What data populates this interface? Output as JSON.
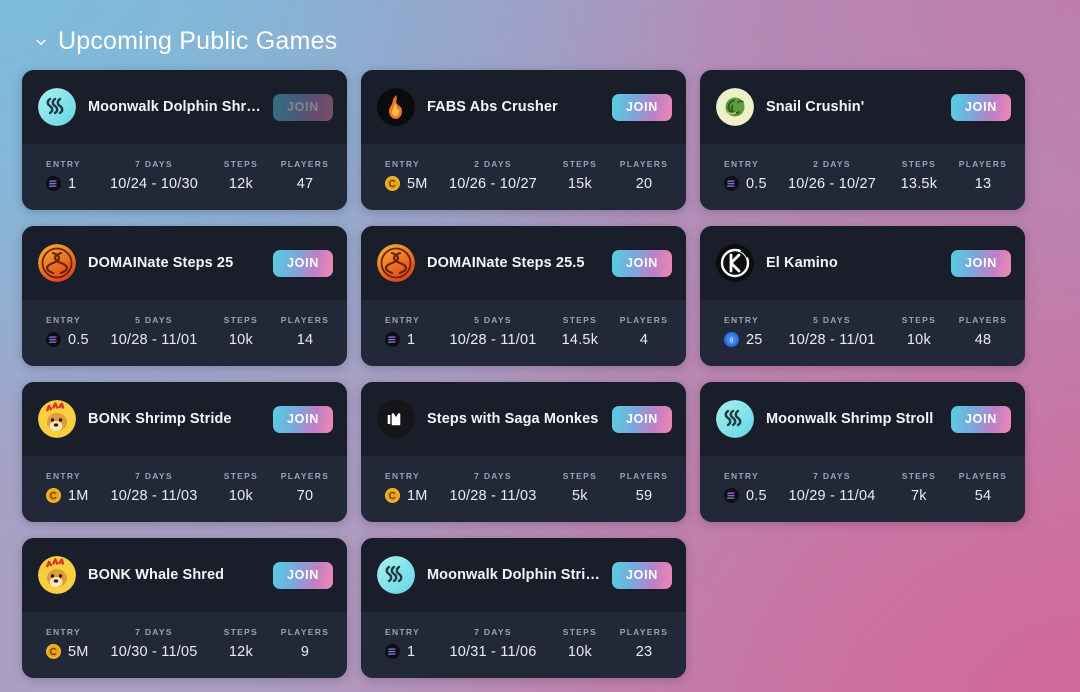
{
  "section": {
    "title": "Upcoming Public Games",
    "chevron": "chevron-down-icon",
    "expanded": true
  },
  "labels": {
    "entry": "ENTRY",
    "steps": "STEPS",
    "players": "PLAYERS",
    "join": "JOIN"
  },
  "colors": {
    "card_head_bg": "#191e2a",
    "card_stats_bg": "#232838",
    "join_gradient_from": "#56cfe1",
    "join_gradient_to": "#ef8ab4",
    "label_text": "#9aa2b4",
    "value_text": "#e9ecf2",
    "bg_top_left": "#7dbadb",
    "bg_top_right": "#bd7eae",
    "bg_bottom_left": "#aba0c4",
    "bg_bottom_right": "#d06a9c"
  },
  "cards": [
    {
      "title": "Moonwalk Dolphin Shred",
      "avatar": "moonwalk-icon",
      "join_label": "JOIN",
      "join_dimmed": true,
      "entry_label": "ENTRY",
      "entry_coin": "solana-coin-icon",
      "entry_value": "1",
      "duration_label": "7 DAYS",
      "date_range": "10/24 - 10/30",
      "steps_label": "STEPS",
      "steps_value": "12k",
      "players_label": "PLAYERS",
      "players_value": "47"
    },
    {
      "title": "FABS Abs Crusher",
      "avatar": "fabs-flame-icon",
      "join_label": "JOIN",
      "join_dimmed": false,
      "entry_label": "ENTRY",
      "entry_coin": "gold-coin-icon",
      "entry_value": "5M",
      "duration_label": "2 DAYS",
      "date_range": "10/26 - 10/27",
      "steps_label": "STEPS",
      "steps_value": "15k",
      "players_label": "PLAYERS",
      "players_value": "20"
    },
    {
      "title": "Snail Crushin'",
      "avatar": "snail-icon",
      "join_label": "JOIN",
      "join_dimmed": false,
      "entry_label": "ENTRY",
      "entry_coin": "solana-coin-icon",
      "entry_value": "0.5",
      "duration_label": "2 DAYS",
      "date_range": "10/26 - 10/27",
      "steps_label": "STEPS",
      "steps_value": "13.5k",
      "players_label": "PLAYERS",
      "players_value": "13"
    },
    {
      "title": "DOMAINate Steps 25",
      "avatar": "domainate-icon",
      "join_label": "JOIN",
      "join_dimmed": false,
      "entry_label": "ENTRY",
      "entry_coin": "solana-coin-icon",
      "entry_value": "0.5",
      "duration_label": "5 DAYS",
      "date_range": "10/28 - 11/01",
      "steps_label": "STEPS",
      "steps_value": "10k",
      "players_label": "PLAYERS",
      "players_value": "14"
    },
    {
      "title": "DOMAINate Steps 25.5",
      "avatar": "domainate-icon",
      "join_label": "JOIN",
      "join_dimmed": false,
      "entry_label": "ENTRY",
      "entry_coin": "solana-coin-icon",
      "entry_value": "1",
      "duration_label": "5 DAYS",
      "date_range": "10/28 - 11/01",
      "steps_label": "STEPS",
      "steps_value": "14.5k",
      "players_label": "PLAYERS",
      "players_value": "4"
    },
    {
      "title": "El Kamino",
      "avatar": "el-kamino-icon",
      "join_label": "JOIN",
      "join_dimmed": false,
      "entry_label": "ENTRY",
      "entry_coin": "blue-coin-icon",
      "entry_value": "25",
      "duration_label": "5 DAYS",
      "date_range": "10/28 - 11/01",
      "steps_label": "STEPS",
      "steps_value": "10k",
      "players_label": "PLAYERS",
      "players_value": "48"
    },
    {
      "title": "BONK Shrimp Stride",
      "avatar": "bonk-dog-icon",
      "join_label": "JOIN",
      "join_dimmed": false,
      "entry_label": "ENTRY",
      "entry_coin": "gold-coin-icon",
      "entry_value": "1M",
      "duration_label": "7 DAYS",
      "date_range": "10/28 - 11/03",
      "steps_label": "STEPS",
      "steps_value": "10k",
      "players_label": "PLAYERS",
      "players_value": "70"
    },
    {
      "title": "Steps with Saga Monkes",
      "avatar": "saga-monkes-icon",
      "join_label": "JOIN",
      "join_dimmed": false,
      "entry_label": "ENTRY",
      "entry_coin": "gold-coin-icon",
      "entry_value": "1M",
      "duration_label": "7 DAYS",
      "date_range": "10/28 - 11/03",
      "steps_label": "STEPS",
      "steps_value": "5k",
      "players_label": "PLAYERS",
      "players_value": "59"
    },
    {
      "title": "Moonwalk Shrimp Stroll",
      "avatar": "moonwalk-icon",
      "join_label": "JOIN",
      "join_dimmed": false,
      "entry_label": "ENTRY",
      "entry_coin": "solana-coin-icon",
      "entry_value": "0.5",
      "duration_label": "7 DAYS",
      "date_range": "10/29 - 11/04",
      "steps_label": "STEPS",
      "steps_value": "7k",
      "players_label": "PLAYERS",
      "players_value": "54"
    },
    {
      "title": "BONK Whale Shred",
      "avatar": "bonk-dog-icon",
      "join_label": "JOIN",
      "join_dimmed": false,
      "entry_label": "ENTRY",
      "entry_coin": "gold-coin-icon",
      "entry_value": "5M",
      "duration_label": "7 DAYS",
      "date_range": "10/30 - 11/05",
      "steps_label": "STEPS",
      "steps_value": "12k",
      "players_label": "PLAYERS",
      "players_value": "9"
    },
    {
      "title": "Moonwalk Dolphin Stride",
      "avatar": "moonwalk-icon",
      "join_label": "JOIN",
      "join_dimmed": false,
      "entry_label": "ENTRY",
      "entry_coin": "solana-coin-icon",
      "entry_value": "1",
      "duration_label": "7 DAYS",
      "date_range": "10/31 - 11/06",
      "steps_label": "STEPS",
      "steps_value": "10k",
      "players_label": "PLAYERS",
      "players_value": "23"
    }
  ]
}
